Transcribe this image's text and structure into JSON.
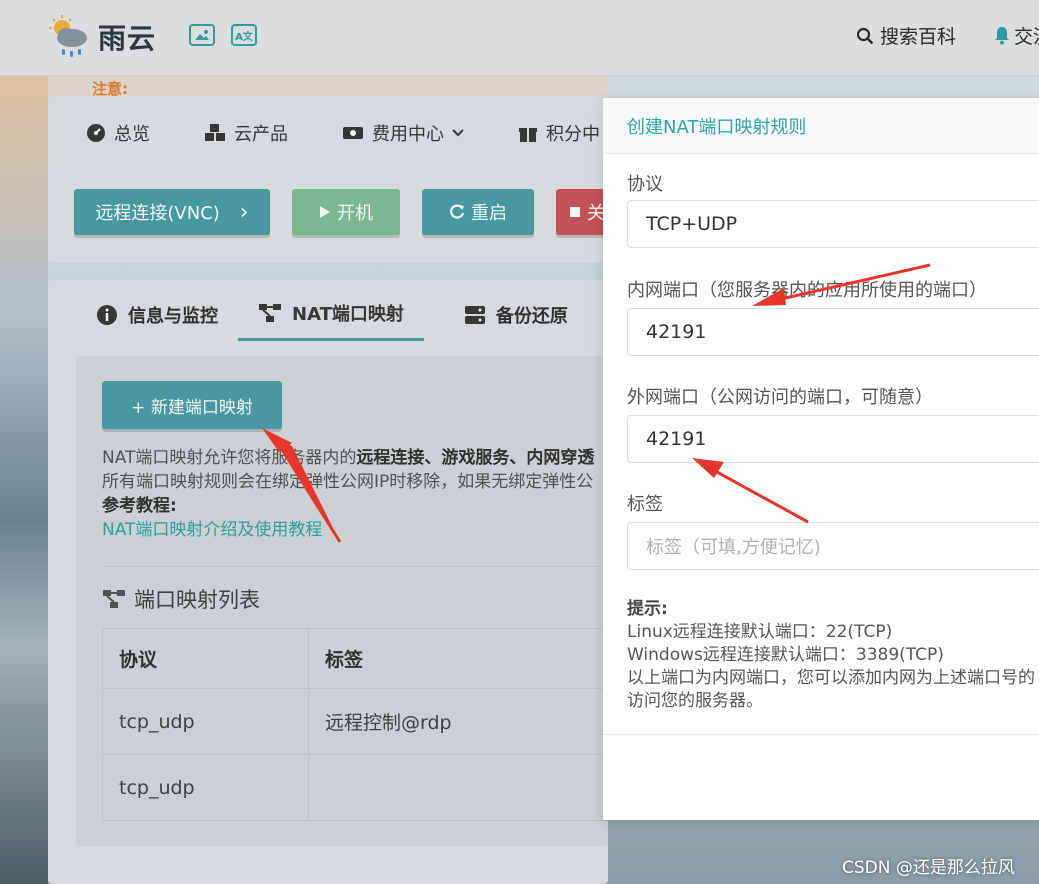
{
  "topbar": {
    "logo_text": "雨云",
    "search_label": "搜索百科",
    "chat_label": "交流"
  },
  "notice": {
    "text": "注意:"
  },
  "menu": {
    "items": [
      {
        "label": "总览",
        "icon": "dashboard-icon"
      },
      {
        "label": "云产品",
        "icon": "cubes-icon"
      },
      {
        "label": "费用中心",
        "icon": "money-icon"
      },
      {
        "label": "积分中",
        "icon": "gift-icon"
      }
    ]
  },
  "actions": {
    "vnc_label": "远程连接(VNC)",
    "vnc_chevron": "›",
    "power_on_label": "开机",
    "restart_label": "重启",
    "shutdown_label": "关机"
  },
  "tabs": [
    {
      "label": "信息与监控",
      "icon": "info-icon"
    },
    {
      "label": "NAT端口映射",
      "icon": "share-nodes-icon"
    },
    {
      "label": "备份还原",
      "icon": "server-icon"
    }
  ],
  "nat": {
    "new_button": "+ 新建端口映射",
    "desc_prefix": "NAT端口映射允许您将服务器内的",
    "desc_bold": "远程连接、游戏服务、内网穿透",
    "desc_line2": "所有端口映射规则会在绑定弹性公网IP时移除，如果无绑定弹性公",
    "ref_label": "参考教程:",
    "ref_link": "NAT端口映射介绍及使用教程",
    "list_title": "端口映射列表",
    "table": {
      "headers": [
        "协议",
        "标签"
      ],
      "rows": [
        [
          "tcp_udp",
          "远程控制@rdp"
        ],
        [
          "tcp_udp",
          ""
        ]
      ]
    }
  },
  "modal": {
    "title": "创建NAT端口映射规则",
    "protocol_label": "协议",
    "protocol_value": "TCP+UDP",
    "inner_port_label": "内网端口（您服务器内的应用所使用的端口）",
    "inner_port_value": "42191",
    "outer_port_label": "外网端口（公网访问的端口，可随意）",
    "outer_port_value": "42191",
    "tag_label": "标签",
    "tag_placeholder": "标签（可填,方便记忆)",
    "tips_title": "提示:",
    "tips_line1": "Linux远程连接默认端口：22(TCP)",
    "tips_line2": "Windows远程连接默认端口：3389(TCP)",
    "tips_line3": "以上端口为内网端口，您可以添加内网为上述端口号的",
    "tips_line4": "访问您的服务器。"
  },
  "watermark": "CSDN @还是那么拉风",
  "colors": {
    "accent": "#4aa0a6",
    "link": "#2fa4a8",
    "danger": "#c9565a",
    "success": "#7fc09b",
    "arrow": "#e8352b"
  }
}
